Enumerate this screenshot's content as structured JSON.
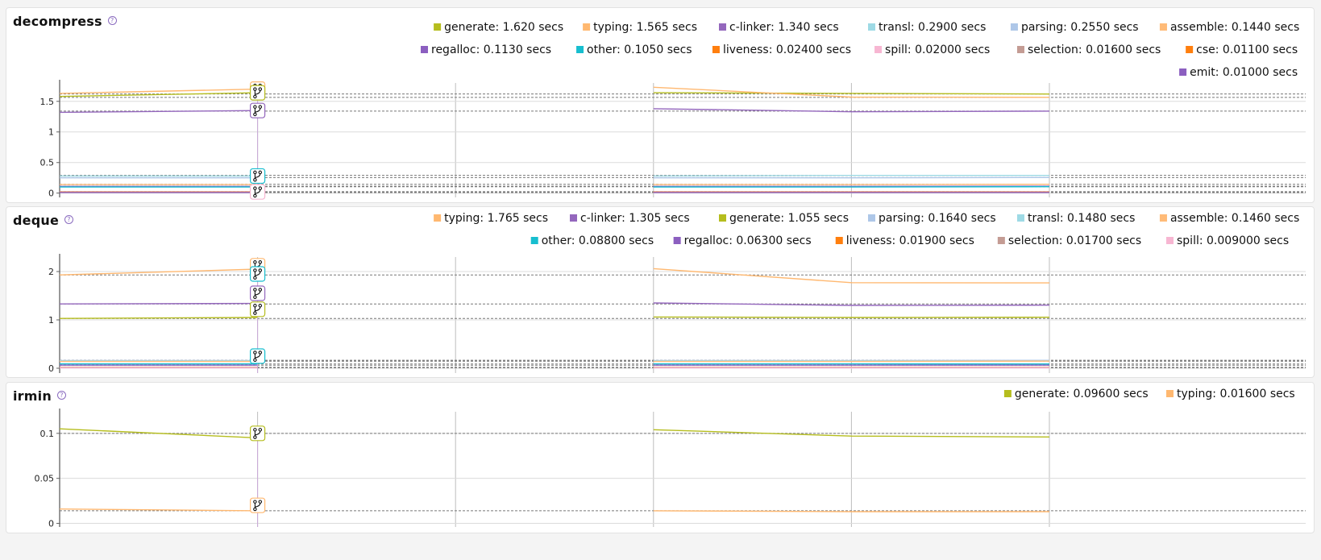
{
  "chart_data": [
    {
      "type": "line",
      "title": "decompress",
      "help_icon": "question-circle-icon",
      "x": [
        0,
        1,
        2,
        3,
        4,
        5
      ],
      "ylim": [
        -0.07,
        1.8
      ],
      "y_ticks": [
        "0",
        "0.5",
        "1",
        "1.5"
      ],
      "y_tick_values": [
        0,
        0.5,
        1,
        1.5
      ],
      "grid": true,
      "legend_position": "top-right",
      "series": [
        {
          "name": "generate",
          "legend": "generate: 1.620 secs",
          "color": "#b5bd1e",
          "values": [
            1.58,
            1.64,
            null,
            1.64,
            1.63,
            1.62
          ]
        },
        {
          "name": "typing",
          "legend": "typing: 1.565 secs",
          "color": "#ffb870",
          "values": [
            1.63,
            1.7,
            null,
            1.73,
            1.57,
            1.565
          ]
        },
        {
          "name": "c-linker",
          "legend": "c-linker: 1.340 secs",
          "color": "#9467bd",
          "values": [
            1.32,
            1.35,
            null,
            1.38,
            1.33,
            1.34
          ]
        },
        {
          "name": "transl",
          "legend": "transl: 0.2900 secs",
          "color": "#9edae5",
          "values": [
            0.28,
            0.28,
            null,
            0.28,
            0.29,
            0.29
          ]
        },
        {
          "name": "parsing",
          "legend": "parsing: 0.2550 secs",
          "color": "#aec7e8",
          "values": [
            0.25,
            0.25,
            null,
            0.25,
            0.25,
            0.255
          ]
        },
        {
          "name": "assemble",
          "legend": "assemble: 0.1440 secs",
          "color": "#ffbb78",
          "values": [
            0.14,
            0.14,
            null,
            0.14,
            0.14,
            0.144
          ]
        },
        {
          "name": "regalloc",
          "legend": "regalloc: 0.1130 secs",
          "color": "#8c5fc0",
          "values": [
            0.11,
            0.11,
            null,
            0.11,
            0.11,
            0.113
          ]
        },
        {
          "name": "other",
          "legend": "other: 0.1050 secs",
          "color": "#17becf",
          "values": [
            0.1,
            0.1,
            null,
            0.1,
            0.1,
            0.105
          ]
        },
        {
          "name": "liveness",
          "legend": "liveness: 0.02400 secs",
          "color": "#ff7f0e",
          "values": [
            0.024,
            0.024,
            null,
            0.024,
            0.024,
            0.024
          ]
        },
        {
          "name": "spill",
          "legend": "spill: 0.02000 secs",
          "color": "#f7b6d2",
          "values": [
            0.02,
            0.02,
            null,
            0.02,
            0.02,
            0.02
          ]
        },
        {
          "name": "selection",
          "legend": "selection: 0.01600 secs",
          "color": "#c49c94",
          "values": [
            0.016,
            0.016,
            null,
            0.016,
            0.016,
            0.016
          ]
        },
        {
          "name": "cse",
          "legend": "cse: 0.01100 secs",
          "color": "#ff7f0e",
          "values": [
            0.011,
            0.011,
            null,
            0.011,
            0.011,
            0.011
          ]
        },
        {
          "name": "emit",
          "legend": "emit: 0.01000 secs",
          "color": "#8c5fc0",
          "values": [
            0.01,
            0.01,
            null,
            0.01,
            0.01,
            0.01
          ]
        }
      ],
      "baselines": [
        1.62,
        1.565,
        1.34,
        0.29,
        0.255,
        0.144,
        0.113,
        0.105,
        0.024,
        0.02,
        0.016,
        0.011,
        0.01
      ],
      "markers": [
        {
          "value": 1.7,
          "color": "#ffb870"
        },
        {
          "value": 1.64,
          "color": "#b5bd1e"
        },
        {
          "value": 1.35,
          "color": "#9467bd"
        },
        {
          "value": 0.28,
          "color": "#17becf"
        },
        {
          "value": 0.02,
          "color": "#f7b6d2"
        }
      ]
    },
    {
      "type": "line",
      "title": "deque",
      "help_icon": "question-circle-icon",
      "x": [
        0,
        1,
        2,
        3,
        4,
        5
      ],
      "ylim": [
        -0.1,
        2.3
      ],
      "y_ticks": [
        "0",
        "1",
        "2"
      ],
      "y_tick_values": [
        0,
        1,
        2
      ],
      "grid": true,
      "legend_position": "top-right",
      "series": [
        {
          "name": "typing",
          "legend": "typing: 1.765 secs",
          "color": "#ffb870",
          "values": [
            1.93,
            2.05,
            null,
            2.06,
            1.77,
            1.765
          ]
        },
        {
          "name": "c-linker",
          "legend": "c-linker: 1.305 secs",
          "color": "#9467bd",
          "values": [
            1.33,
            1.34,
            null,
            1.35,
            1.3,
            1.305
          ]
        },
        {
          "name": "generate",
          "legend": "generate: 1.055 secs",
          "color": "#b5bd1e",
          "values": [
            1.03,
            1.05,
            null,
            1.06,
            1.05,
            1.055
          ]
        },
        {
          "name": "parsing",
          "legend": "parsing: 0.1640 secs",
          "color": "#aec7e8",
          "values": [
            0.16,
            0.16,
            null,
            0.16,
            0.16,
            0.164
          ]
        },
        {
          "name": "transl",
          "legend": "transl: 0.1480 secs",
          "color": "#9edae5",
          "values": [
            0.15,
            0.15,
            null,
            0.15,
            0.15,
            0.148
          ]
        },
        {
          "name": "assemble",
          "legend": "assemble: 0.1460 secs",
          "color": "#ffbb78",
          "values": [
            0.14,
            0.14,
            null,
            0.14,
            0.14,
            0.146
          ]
        },
        {
          "name": "other",
          "legend": "other: 0.08800 secs",
          "color": "#17becf",
          "values": [
            0.09,
            0.09,
            null,
            0.09,
            0.09,
            0.088
          ]
        },
        {
          "name": "regalloc",
          "legend": "regalloc: 0.06300 secs",
          "color": "#8c5fc0",
          "values": [
            0.063,
            0.063,
            null,
            0.063,
            0.063,
            0.063
          ]
        },
        {
          "name": "liveness",
          "legend": "liveness: 0.01900 secs",
          "color": "#ff7f0e",
          "values": [
            0.019,
            0.019,
            null,
            0.019,
            0.019,
            0.019
          ]
        },
        {
          "name": "selection",
          "legend": "selection: 0.01700 secs",
          "color": "#c49c94",
          "values": [
            0.017,
            0.017,
            null,
            0.017,
            0.017,
            0.017
          ]
        },
        {
          "name": "spill",
          "legend": "spill: 0.009000 secs",
          "color": "#f7b6d2",
          "values": [
            0.009,
            0.009,
            null,
            0.009,
            0.009,
            0.009
          ]
        }
      ],
      "baselines": [
        1.93,
        1.33,
        1.03,
        0.164,
        0.148,
        0.146,
        0.088,
        0.063,
        0.019,
        0.017,
        0.009
      ],
      "markers": [
        {
          "value": 2.12,
          "color": "#ffb870"
        },
        {
          "value": 1.95,
          "color": "#17becf"
        },
        {
          "value": 1.55,
          "color": "#9467bd"
        },
        {
          "value": 1.22,
          "color": "#b5bd1e"
        },
        {
          "value": 0.25,
          "color": "#17becf"
        }
      ]
    },
    {
      "type": "line",
      "title": "irmin",
      "help_icon": "question-circle-icon",
      "x": [
        0,
        1,
        2,
        3,
        4,
        5
      ],
      "ylim": [
        -0.004,
        0.124
      ],
      "y_ticks": [
        "0",
        "0.05",
        "0.1"
      ],
      "y_tick_values": [
        0,
        0.05,
        0.1
      ],
      "grid": true,
      "legend_position": "top-right",
      "series": [
        {
          "name": "generate",
          "legend": "generate: 0.09600 secs",
          "color": "#b5bd1e",
          "values": [
            0.105,
            0.095,
            null,
            0.104,
            0.097,
            0.096
          ]
        },
        {
          "name": "typing",
          "legend": "typing: 0.01600 secs",
          "color": "#ffb870",
          "values": [
            0.016,
            0.014,
            null,
            0.014,
            0.013,
            0.013
          ]
        }
      ],
      "baselines": [
        0.1,
        0.014
      ],
      "markers": [
        {
          "value": 0.1,
          "color": "#b5bd1e"
        },
        {
          "value": 0.02,
          "color": "#ffb870"
        }
      ]
    }
  ]
}
